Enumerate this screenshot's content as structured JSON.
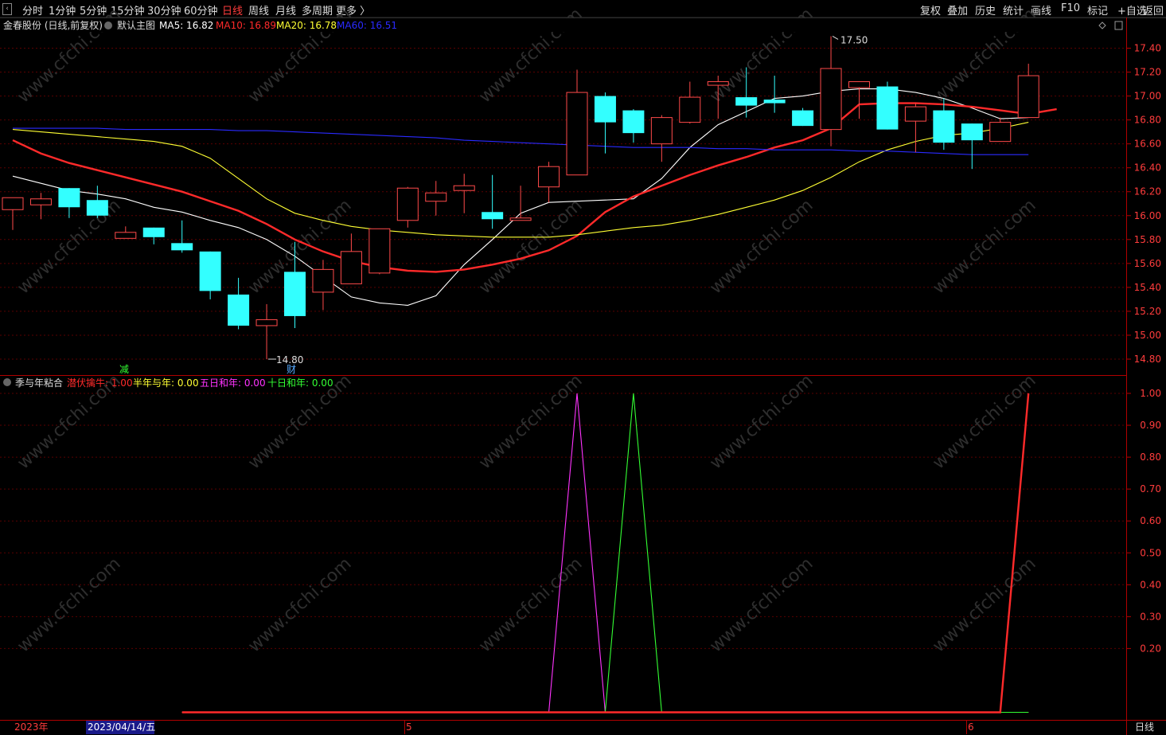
{
  "toolbar": {
    "left": [
      "分时",
      "1分钟",
      "5分钟",
      "15分钟",
      "30分钟",
      "60分钟",
      "日线",
      "周线",
      "月线",
      "多周期",
      "更多 〉"
    ],
    "active": "日线",
    "right": [
      "复权",
      "叠加",
      "历史",
      "统计",
      "画线",
      "F10",
      "标记",
      "+自选",
      "返回"
    ]
  },
  "main_header": {
    "stock": "金春股份 (日线,前复权)",
    "template": "默认主图",
    "ma": [
      {
        "label": "MA5: 16.82",
        "color": "#ffffff"
      },
      {
        "label": "MA10: 16.89",
        "color": "#ff2a2a"
      },
      {
        "label": "MA20: 16.78",
        "color": "#ffff33"
      },
      {
        "label": "MA60: 16.51",
        "color": "#2a2aff"
      }
    ]
  },
  "sub_header": {
    "name": "季与年粘合",
    "items": [
      {
        "label": "潜伏擒牛: 1.00",
        "color": "#ff2a2a"
      },
      {
        "label": "半年与年: 0.00",
        "color": "#ffff33"
      },
      {
        "label": "五日和年: 0.00",
        "color": "#ff33ff"
      },
      {
        "label": "十日和年: 0.00",
        "color": "#33ff33"
      }
    ]
  },
  "annotations": {
    "high": "17.50",
    "low": "14.80",
    "mark_jian": "减",
    "mark_cai": "财"
  },
  "bottom_axis": {
    "year": "2023年",
    "cursor_date": "2023/04/14/五",
    "month5": "5",
    "month6": "6",
    "period": "日线"
  },
  "watermark": "www.cfchi.com",
  "chart_data": [
    {
      "type": "candlestick",
      "yaxis": {
        "min": 14.8,
        "max": 17.4,
        "ticks": [
          "14.80",
          "15.00",
          "15.20",
          "15.40",
          "15.60",
          "15.80",
          "16.00",
          "16.20",
          "16.40",
          "16.60",
          "16.80",
          "17.00",
          "17.20",
          "17.40"
        ]
      },
      "candles": [
        {
          "o": 16.05,
          "c": 16.15,
          "h": 16.15,
          "l": 15.88
        },
        {
          "o": 16.09,
          "c": 16.14,
          "h": 16.19,
          "l": 15.97
        },
        {
          "o": 16.23,
          "c": 16.07,
          "h": 16.23,
          "l": 15.98
        },
        {
          "o": 16.13,
          "c": 16.0,
          "h": 16.25,
          "l": 15.98
        },
        {
          "o": 15.81,
          "c": 15.86,
          "h": 15.91,
          "l": 15.81
        },
        {
          "o": 15.9,
          "c": 15.82,
          "h": 15.9,
          "l": 15.76
        },
        {
          "o": 15.77,
          "c": 15.71,
          "h": 15.96,
          "l": 15.69
        },
        {
          "o": 15.7,
          "c": 15.37,
          "h": 15.7,
          "l": 15.3
        },
        {
          "o": 15.34,
          "c": 15.08,
          "h": 15.48,
          "l": 15.05
        },
        {
          "o": 15.08,
          "c": 15.13,
          "h": 15.26,
          "l": 14.8
        },
        {
          "o": 15.53,
          "c": 15.16,
          "h": 15.78,
          "l": 15.06
        },
        {
          "o": 15.36,
          "c": 15.55,
          "h": 15.63,
          "l": 15.21
        },
        {
          "o": 15.43,
          "c": 15.7,
          "h": 15.85,
          "l": 15.43
        },
        {
          "o": 15.52,
          "c": 15.89,
          "h": 15.89,
          "l": 15.51
        },
        {
          "o": 15.96,
          "c": 16.23,
          "h": 16.24,
          "l": 15.9
        },
        {
          "o": 16.12,
          "c": 16.19,
          "h": 16.29,
          "l": 16.0
        },
        {
          "o": 16.21,
          "c": 16.25,
          "h": 16.35,
          "l": 16.02
        },
        {
          "o": 16.03,
          "c": 15.97,
          "h": 16.34,
          "l": 15.89
        },
        {
          "o": 15.96,
          "c": 15.98,
          "h": 16.25,
          "l": 15.96
        },
        {
          "o": 16.24,
          "c": 16.41,
          "h": 16.45,
          "l": 16.11
        },
        {
          "o": 16.34,
          "c": 17.03,
          "h": 17.22,
          "l": 16.34
        },
        {
          "o": 17.0,
          "c": 16.78,
          "h": 17.03,
          "l": 16.52
        },
        {
          "o": 16.88,
          "c": 16.69,
          "h": 16.89,
          "l": 16.61
        },
        {
          "o": 16.6,
          "c": 16.82,
          "h": 16.84,
          "l": 16.45
        },
        {
          "o": 16.78,
          "c": 16.99,
          "h": 17.12,
          "l": 16.77
        },
        {
          "o": 17.09,
          "c": 17.12,
          "h": 17.17,
          "l": 16.81
        },
        {
          "o": 16.99,
          "c": 16.92,
          "h": 17.24,
          "l": 16.82
        },
        {
          "o": 16.97,
          "c": 16.94,
          "h": 17.17,
          "l": 16.86
        },
        {
          "o": 16.88,
          "c": 16.75,
          "h": 16.9,
          "l": 16.75
        },
        {
          "o": 16.72,
          "c": 17.23,
          "h": 17.5,
          "l": 16.58
        },
        {
          "o": 17.07,
          "c": 17.12,
          "h": 17.12,
          "l": 16.81
        },
        {
          "o": 17.08,
          "c": 16.72,
          "h": 17.12,
          "l": 16.72
        },
        {
          "o": 16.79,
          "c": 16.91,
          "h": 16.94,
          "l": 16.53
        },
        {
          "o": 16.88,
          "c": 16.61,
          "h": 16.98,
          "l": 16.55
        },
        {
          "o": 16.77,
          "c": 16.63,
          "h": 16.77,
          "l": 16.39
        },
        {
          "o": 16.62,
          "c": 16.78,
          "h": 16.82,
          "l": 16.62
        },
        {
          "o": 16.82,
          "c": 17.17,
          "h": 17.27,
          "l": 16.82
        }
      ],
      "ma_series": [
        {
          "name": "MA5",
          "color": "#ffffff",
          "values": [
            16.33,
            16.27,
            16.21,
            16.18,
            16.14,
            16.07,
            16.03,
            15.96,
            15.9,
            15.8,
            15.66,
            15.49,
            15.32,
            15.27,
            15.25,
            15.33,
            15.59,
            15.8,
            16.02,
            16.11,
            16.12,
            16.13,
            16.14,
            16.31,
            16.57,
            16.76,
            16.87,
            16.98,
            17.0,
            17.04,
            17.06,
            17.06,
            17.03,
            16.98,
            16.9,
            16.81,
            16.82
          ]
        },
        {
          "name": "MA10",
          "color": "#ff2a2a",
          "values": [
            16.63,
            16.52,
            16.44,
            16.38,
            16.32,
            16.26,
            16.2,
            16.12,
            16.04,
            15.93,
            15.8,
            15.7,
            15.62,
            15.57,
            15.54,
            15.53,
            15.55,
            15.59,
            15.64,
            15.71,
            15.83,
            16.03,
            16.16,
            16.25,
            16.34,
            16.42,
            16.49,
            16.57,
            16.63,
            16.73,
            16.93,
            16.94,
            16.94,
            16.93,
            16.91,
            16.88,
            16.85,
            16.89
          ]
        },
        {
          "name": "MA20",
          "color": "#ffff33",
          "values": [
            16.72,
            16.7,
            16.68,
            16.66,
            16.64,
            16.62,
            16.58,
            16.48,
            16.31,
            16.14,
            16.02,
            15.96,
            15.91,
            15.88,
            15.86,
            15.84,
            15.83,
            15.82,
            15.82,
            15.82,
            15.84,
            15.87,
            15.9,
            15.92,
            15.96,
            16.01,
            16.07,
            16.13,
            16.21,
            16.32,
            16.45,
            16.55,
            16.62,
            16.67,
            16.69,
            16.73,
            16.78
          ]
        },
        {
          "name": "MA60",
          "color": "#2a2aff",
          "values": [
            16.73,
            16.73,
            16.73,
            16.73,
            16.72,
            16.72,
            16.72,
            16.72,
            16.71,
            16.71,
            16.7,
            16.69,
            16.68,
            16.67,
            16.66,
            16.65,
            16.63,
            16.62,
            16.61,
            16.6,
            16.59,
            16.58,
            16.57,
            16.57,
            16.57,
            16.56,
            16.56,
            16.55,
            16.55,
            16.55,
            16.54,
            16.54,
            16.53,
            16.52,
            16.51,
            16.51,
            16.51
          ]
        }
      ]
    },
    {
      "type": "line",
      "title": "季与年粘合",
      "yaxis": {
        "min": 0,
        "max": 1,
        "ticks": [
          "0.20",
          "0.30",
          "0.40",
          "0.50",
          "0.60",
          "0.70",
          "0.80",
          "0.90",
          "1.00"
        ]
      },
      "series": [
        {
          "name": "潜伏擒牛",
          "color": "#ff2a2a",
          "values": [
            0,
            0,
            0,
            0,
            0,
            0,
            0,
            0,
            0,
            0,
            0,
            0,
            0,
            0,
            0,
            0,
            0,
            0,
            0,
            0,
            0,
            0,
            0,
            0,
            0,
            0,
            0,
            0,
            0,
            0,
            0,
            0,
            0,
            0,
            0,
            0,
            1
          ]
        },
        {
          "name": "半年与年",
          "color": "#ffff33",
          "values": [
            0,
            0,
            0,
            0,
            0,
            0,
            0,
            0,
            0,
            0,
            0,
            0,
            0,
            0,
            0,
            0,
            0,
            0,
            0,
            0,
            0,
            0,
            0,
            0,
            0,
            0,
            0,
            0,
            0,
            0,
            0,
            0,
            0,
            0,
            0,
            0,
            0
          ]
        },
        {
          "name": "五日和年",
          "color": "#ff33ff",
          "values": [
            0,
            0,
            0,
            0,
            0,
            0,
            0,
            0,
            0,
            0,
            0,
            0,
            0,
            0,
            0,
            0,
            0,
            0,
            0,
            0,
            1,
            0,
            0,
            0,
            0,
            0,
            0,
            0,
            0,
            0,
            0,
            0,
            0,
            0,
            0,
            0,
            0
          ]
        },
        {
          "name": "十日和年",
          "color": "#33ff33",
          "values": [
            0,
            0,
            0,
            0,
            0,
            0,
            0,
            0,
            0,
            0,
            0,
            0,
            0,
            0,
            0,
            0,
            0,
            0,
            0,
            0,
            0,
            0,
            1,
            0,
            0,
            0,
            0,
            0,
            0,
            0,
            0,
            0,
            0,
            0,
            0,
            0,
            0
          ]
        }
      ]
    }
  ]
}
